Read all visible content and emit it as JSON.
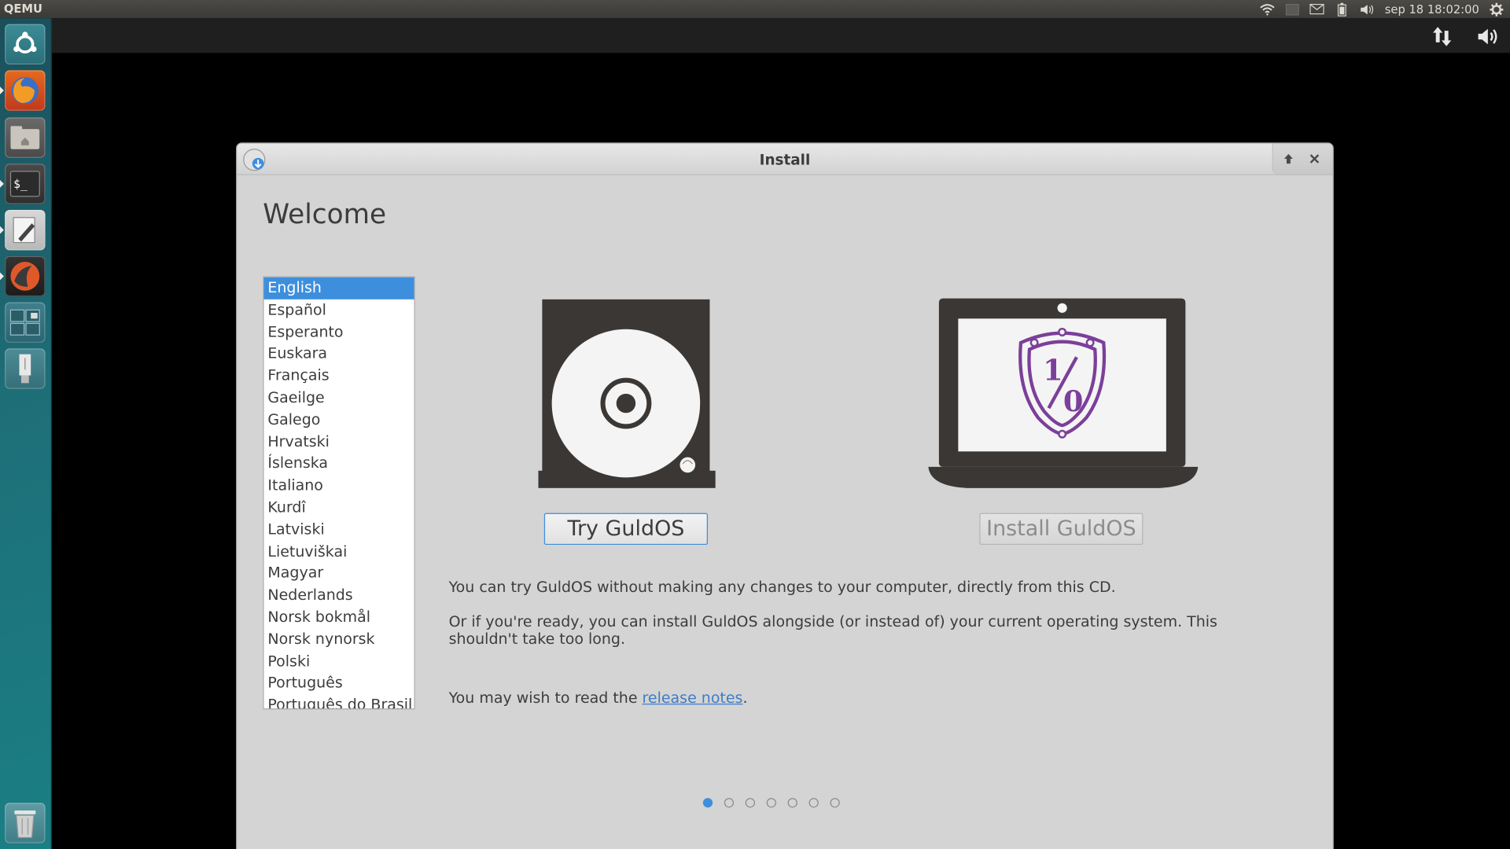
{
  "topbar": {
    "app_title": "QEMU",
    "clock": "sep 18 18:02:00",
    "icons": [
      "wifi-icon",
      "keyboard-icon",
      "mail-icon",
      "battery-icon",
      "volume-icon",
      "gear-icon"
    ]
  },
  "guest_panel": {
    "icons": [
      "network-transfer-icon",
      "volume-icon"
    ]
  },
  "launcher": {
    "items": [
      "dash-home",
      "firefox",
      "files",
      "terminal",
      "text-editor",
      "installer",
      "workspaces",
      "usb-drive",
      "trash"
    ]
  },
  "window": {
    "title": "Install",
    "heading": "Welcome",
    "languages": [
      "English",
      "Español",
      "Esperanto",
      "Euskara",
      "Français",
      "Gaeilge",
      "Galego",
      "Hrvatski",
      "Íslenska",
      "Italiano",
      "Kurdî",
      "Latviski",
      "Lietuviškai",
      "Magyar",
      "Nederlands",
      "Norsk bokmål",
      "Norsk nynorsk",
      "Polski",
      "Português",
      "Português do Brasil"
    ],
    "selected_language": "English",
    "try_button": "Try GuldOS",
    "install_button": "Install GuldOS",
    "desc_try": "You can try GuldOS without making any changes to your computer, directly from this CD.",
    "desc_install": "Or if you're ready, you can install GuldOS alongside (or instead of) your current operating system.  This shouldn't take too long.",
    "release_prefix": "You may wish to read the ",
    "release_link": "release notes",
    "release_suffix": ".",
    "page_dots_total": 7,
    "page_dots_active": 1,
    "colors": {
      "accent": "#3d8fde",
      "artwork": "#3a3735",
      "shield": "#7b3f9a"
    }
  }
}
